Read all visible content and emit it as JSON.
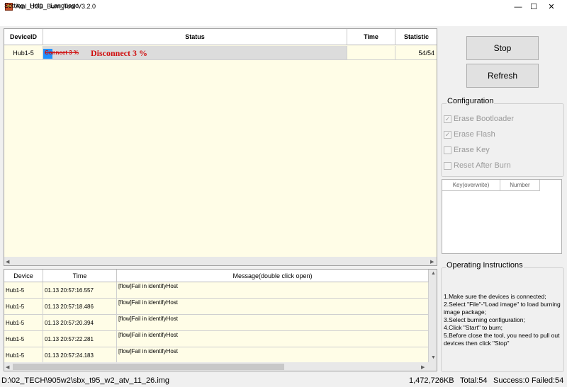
{
  "window": {
    "title": "Aml_USB_Burn_Tool V3.2.0",
    "min": "—",
    "max": "☐",
    "close": "✕"
  },
  "menu": [
    "Setting",
    "Help",
    "Language"
  ],
  "device_grid": {
    "headers": [
      "DeviceID",
      "Status",
      "Time",
      "Statistic"
    ],
    "row": {
      "device": "Hub1-5",
      "status_strike": "Connect 3 %",
      "status": "Disconnect 3 %",
      "time": "",
      "statistic": "54/54"
    },
    "progress": 0.03,
    "progress_color": "#1e90ff",
    "status_color": "#d01010"
  },
  "log_grid": {
    "headers": [
      "Device",
      "Time",
      "Message(double click open)"
    ],
    "rows": [
      {
        "device": "Hub1-5",
        "time": "01.13 20:57:16.557",
        "message": "[flow]Fail in identifyHost"
      },
      {
        "device": "Hub1-5",
        "time": "01.13 20:57:18.486",
        "message": "[flow]Fail in identifyHost"
      },
      {
        "device": "Hub1-5",
        "time": "01.13 20:57:20.394",
        "message": "[flow]Fail in identifyHost"
      },
      {
        "device": "Hub1-5",
        "time": "01.13 20:57:22.281",
        "message": "[flow]Fail in identifyHost"
      },
      {
        "device": "Hub1-5",
        "time": "01.13 20:57:24.183",
        "message": "[flow]Fail in identifyHost"
      }
    ]
  },
  "buttons": {
    "stop": "Stop",
    "refresh": "Refresh"
  },
  "configuration": {
    "title": "Configuration",
    "options": [
      {
        "label": "Erase Bootloader",
        "checked": true
      },
      {
        "label": "Erase Flash",
        "checked": true
      },
      {
        "label": "Erase Key",
        "checked": false
      },
      {
        "label": "Reset After Burn",
        "checked": false
      }
    ]
  },
  "key_table": {
    "headers": [
      "Key(overwrite)",
      "Number"
    ]
  },
  "instructions": {
    "title": "Operating Instructions",
    "text": "1.Make sure the devices is connected;\n2.Select \"File\"-\"Load image\" to load burning image package;\n3.Select burning configuration;\n4.Click \"Start\" to burn;\n5.Before close the tool, you need to pull out devices then click \"Stop\""
  },
  "statusbar": {
    "path": "D:\\02_TECH\\905w2\\sbx_t95_w2_atv_11_26.img",
    "size": "1,472,726KB",
    "total": "Total:54",
    "success": "Success:0",
    "failed": "Failed:54"
  },
  "icons": {
    "app": "usb-burn-app-icon",
    "checkmark": "✓"
  }
}
